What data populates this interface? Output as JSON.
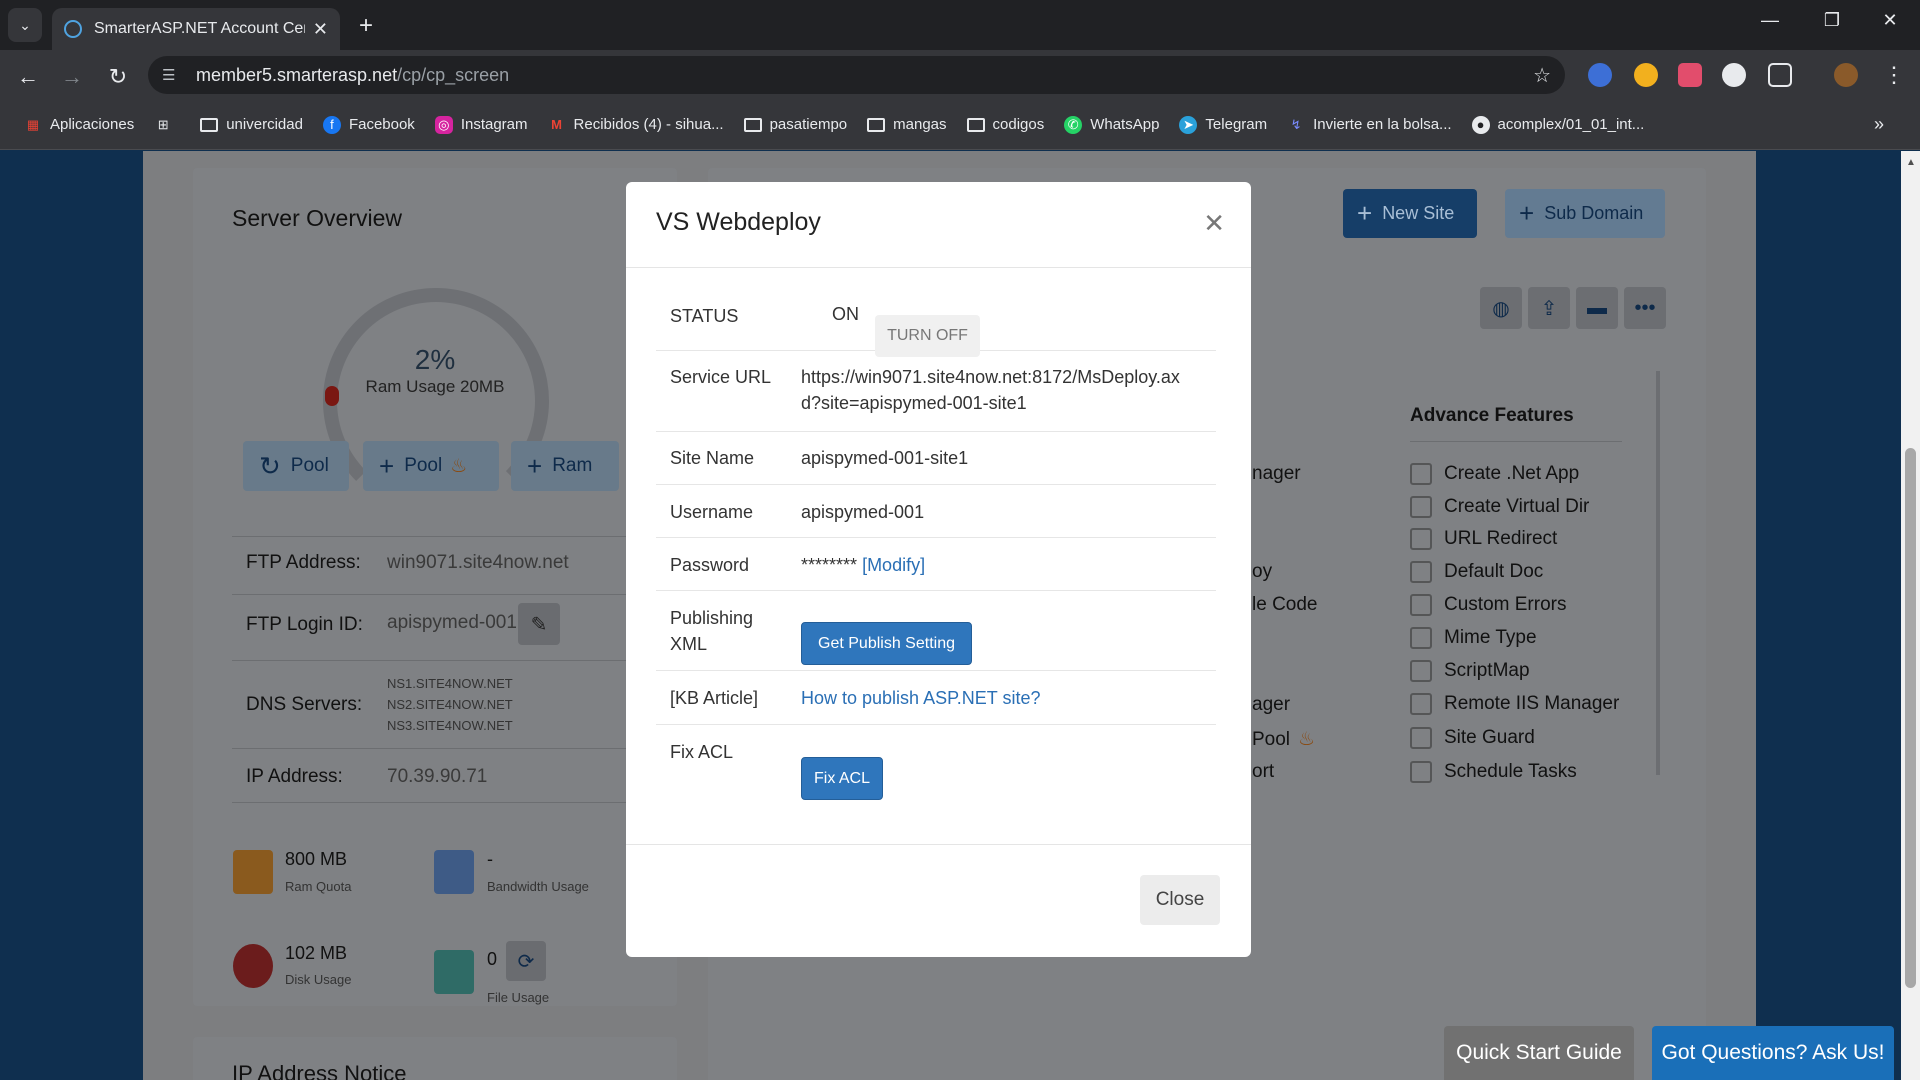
{
  "browser": {
    "tab_title": "SmarterASP.NET Account Cente",
    "url_host": "member5.smarterasp.net",
    "url_path": "/cp/cp_screen",
    "bookmarks": [
      {
        "label": "Aplicaciones",
        "icon": "apps-grid-icon"
      },
      {
        "label": "",
        "icon": "tab-groups-icon"
      },
      {
        "label": "univercidad",
        "icon": "folder-icon"
      },
      {
        "label": "Facebook",
        "icon": "facebook-icon"
      },
      {
        "label": "Instagram",
        "icon": "instagram-icon"
      },
      {
        "label": "Recibidos (4) - sihua...",
        "icon": "gmail-icon"
      },
      {
        "label": "pasatiempo",
        "icon": "folder-icon"
      },
      {
        "label": "mangas",
        "icon": "folder-icon"
      },
      {
        "label": "codigos",
        "icon": "folder-icon"
      },
      {
        "label": "WhatsApp",
        "icon": "whatsapp-icon"
      },
      {
        "label": "Telegram",
        "icon": "telegram-icon"
      },
      {
        "label": "Invierte en la bolsa...",
        "icon": "chart-icon"
      },
      {
        "label": "acomplex/01_01_int...",
        "icon": "github-icon"
      }
    ]
  },
  "server_overview": {
    "title": "Server Overview",
    "gauge_percent": "2%",
    "gauge_label": "Ram Usage 20MB",
    "gauge_fraction": 0.02,
    "buttons": {
      "pool_refresh": "Pool",
      "pool_add": "Pool",
      "ram_add": "Ram"
    },
    "ftp_address_label": "FTP Address:",
    "ftp_address": "win9071.site4now.net",
    "ftp_login_label": "FTP Login ID:",
    "ftp_login": "apispymed-001",
    "dns_label": "DNS Servers:",
    "dns": [
      "NS1.SITE4NOW.NET",
      "NS2.SITE4NOW.NET",
      "NS3.SITE4NOW.NET"
    ],
    "ip_label": "IP Address:",
    "ip": "70.39.90.71",
    "ram_quota_value": "800 MB",
    "ram_quota_label": "Ram Quota",
    "bandwidth_value": "-",
    "bandwidth_label": "Bandwidth Usage",
    "disk_value": "102 MB",
    "disk_label": "Disk Usage",
    "file_value": "0",
    "file_label": "File Usage",
    "ip_notice_title": "IP Address Notice"
  },
  "sites": {
    "new_site": "New Site",
    "sub_domain": "Sub Domain",
    "left_partial": [
      "nager",
      "oy",
      "le Code",
      "ager",
      "Pool",
      "ort"
    ],
    "advance_title": "Advance Features",
    "advance_items": [
      "Create .Net App",
      "Create Virtual Dir",
      "URL Redirect",
      "Default Doc",
      "Custom Errors",
      "Mime Type",
      "ScriptMap",
      "Remote IIS Manager",
      "Site Guard",
      "Schedule Tasks"
    ]
  },
  "modal": {
    "title": "VS Webdeploy",
    "status_label": "STATUS",
    "status_value": "ON",
    "turn_off": "TURN OFF",
    "service_url_label": "Service URL",
    "service_url_line1": "https://win9071.site4now.net:8172/MsDeploy.ax",
    "service_url_line2": "d?site=apispymed-001-site1",
    "site_name_label": "Site Name",
    "site_name": "apispymed-001-site1",
    "username_label": "Username",
    "username": "apispymed-001",
    "password_label": "Password",
    "password_mask": "********",
    "password_modify": "[Modify]",
    "publishing_label_1": "Publishing",
    "publishing_label_2": "XML",
    "publish_button": "Get Publish Setting",
    "kb_label": "[KB Article]",
    "kb_link": "How to publish ASP.NET site?",
    "fix_acl_label": "Fix ACL",
    "fix_acl_button": "Fix ACL",
    "close_button": "Close"
  },
  "floating": {
    "quick_start": "Quick Start Guide",
    "got_questions": "Got Questions? Ask Us!"
  },
  "colors": {
    "primary": "#2f76bc",
    "page_dim": "#7d7e80",
    "brand_dark": "#0f2f4f"
  }
}
